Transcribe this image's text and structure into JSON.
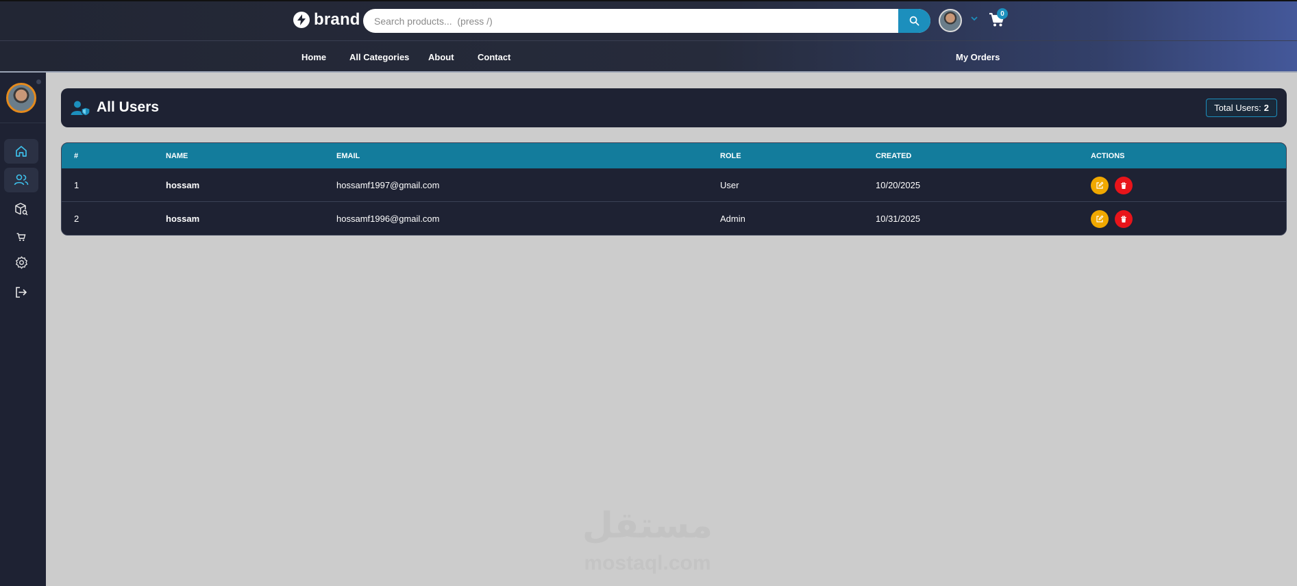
{
  "header": {
    "brand": "brand",
    "search_placeholder": "Search products...  (press /)",
    "cart_count": "0"
  },
  "nav": {
    "links": [
      "Home",
      "All Categories",
      "About",
      "Contact"
    ],
    "my_orders": "My Orders"
  },
  "page": {
    "title": "All Users",
    "total_label": "Total Users:",
    "total_value": "2"
  },
  "table": {
    "columns": [
      "#",
      "NAME",
      "EMAIL",
      "ROLE",
      "CREATED",
      "ACTIONS"
    ],
    "rows": [
      {
        "index": "1",
        "name": "hossam",
        "email": "hossamf1997@gmail.com",
        "role": "User",
        "created": "10/20/2025"
      },
      {
        "index": "2",
        "name": "hossam",
        "email": "hossamf1996@gmail.com",
        "role": "Admin",
        "created": "10/31/2025"
      }
    ]
  },
  "watermark": {
    "arabic": "مستقل",
    "latin": "mostaql.com"
  },
  "colors": {
    "accent": "#1c8fbd",
    "table_header": "#137c9c",
    "card_bg": "#1e2233",
    "edit": "#f0a800",
    "delete": "#e8141a"
  },
  "sidebar": {
    "icons": [
      "home-icon",
      "users-icon",
      "products-icon",
      "cart-icon",
      "settings-icon",
      "logout-icon"
    ]
  }
}
